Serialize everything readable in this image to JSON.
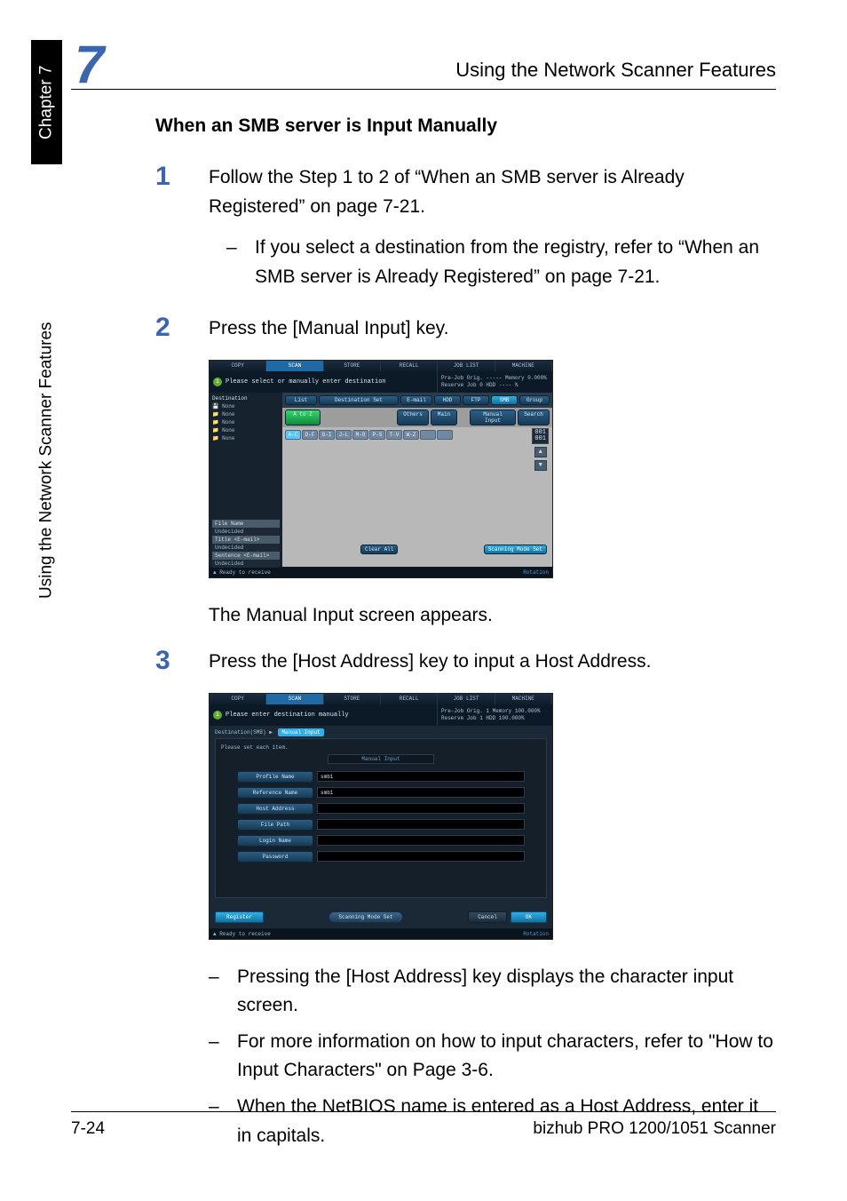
{
  "chapter_tab": "Chapter 7",
  "side_label": "Using the Network Scanner Features",
  "header": {
    "number": "7",
    "right": "Using the Network Scanner Features"
  },
  "section_title": "When an SMB server is Input Manually",
  "steps": {
    "s1": {
      "num": "1",
      "text": "Follow the Step 1 to 2 of “When an SMB server is Already Registered” on page 7-21.",
      "bullet1": "If you select a destination from the registry, refer to “When an SMB server is Already Registered” on page 7-21."
    },
    "s2": {
      "num": "2",
      "text": "Press the [Manual Input] key."
    },
    "s2_caption": "The Manual Input screen appears.",
    "s3": {
      "num": "3",
      "text": "Press the [Host Address] key to input a Host Address."
    },
    "s3_bullets": {
      "b1": "Pressing the [Host Address] key displays the character input screen.",
      "b2": "For more information on how to input characters, refer to \"How to Input Characters\" on Page 3-6.",
      "b3": "When the NetBIOS name is entered as a Host Address, enter it in capitals."
    }
  },
  "shot1": {
    "tabs": {
      "copy": "COPY",
      "scan": "SCAN",
      "store": "STORE",
      "recall": "RECALL",
      "joblist": "JOB LIST",
      "machine": "MACHINE"
    },
    "info_msg": "Please select or manually enter destination",
    "status": {
      "l1": "Pre-Job Orig.  -----   Memory    0.000%",
      "l2": "Reserve Job     0   HDD       ---- %"
    },
    "side_hdr": "Destination",
    "side_rows": [
      "None",
      "None",
      "None",
      "None",
      "None"
    ],
    "side_bottom": {
      "fn_lbl": "File Name",
      "fn_val": "Undecided",
      "tt_lbl": "Title <E-mail>",
      "tt_val": "Undecided",
      "sn_lbl": "Sentence <E-mail>",
      "sn_val": "Undecided"
    },
    "top_row": [
      "List",
      "Destination Set",
      "E-mail",
      "HDD",
      "FTP",
      "SMB",
      "Group"
    ],
    "row2": {
      "atoz": "A to Z",
      "others": "Others",
      "main": "Main",
      "manual": "Manual Input",
      "search": "Search"
    },
    "alpha": [
      "A-C",
      "D-F",
      "G-I",
      "J-L",
      "M-O",
      "P-S",
      "T-V",
      "W-Z",
      "",
      ""
    ],
    "pager": {
      "pg": "001\n001"
    },
    "clear": "Clear All",
    "scanmode": "Scanning Mode Set",
    "footer_left": "Ready to receive",
    "footer_right": "Rotation"
  },
  "shot2": {
    "info_msg": "Please enter destination manually",
    "status": {
      "l1": "Pre-Job Orig.   1   Memory   100.000%",
      "l2": "Reserve Job    1   HDD      100.000%"
    },
    "crumb_left": "Destination(SMB)",
    "crumb_right": "Manual Input",
    "note": "Please set each item.",
    "tab": "Manual Input",
    "fields": {
      "profile": {
        "label": "Profile Name",
        "value": "smb1"
      },
      "reference": {
        "label": "Reference Name",
        "value": "smb1"
      },
      "host": {
        "label": "Host Address",
        "value": ""
      },
      "path": {
        "label": "File Path",
        "value": ""
      },
      "login": {
        "label": "Login Name",
        "value": ""
      },
      "pass": {
        "label": "Password",
        "value": ""
      }
    },
    "register": "Register",
    "scanmode": "Scanning Mode Set",
    "cancel": "Cancel",
    "ok": "OK",
    "footer_left": "Ready to receive",
    "footer_right": "Rotation"
  },
  "footer": {
    "left": "7-24",
    "right": "bizhub PRO 1200/1051 Scanner"
  }
}
